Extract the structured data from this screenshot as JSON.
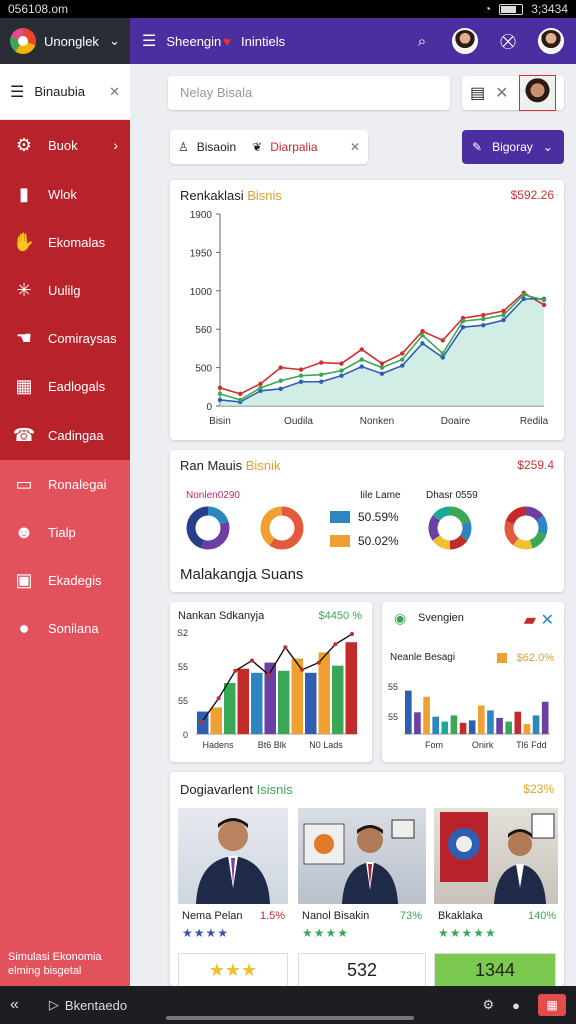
{
  "status": {
    "time": "056108.om",
    "battery": "3;3434",
    "battery_level": 0.75
  },
  "app": {
    "name": "Unonglek",
    "header_title": "Sheengin",
    "header_subtitle": "Inintiels"
  },
  "sidebar": {
    "title": "Binaubia",
    "items": [
      {
        "label": "Buok",
        "icon": "gear-icon"
      },
      {
        "label": "Wlok",
        "icon": "bag-icon"
      },
      {
        "label": "Ekomalas",
        "icon": "hand-coins-icon"
      },
      {
        "label": "Uulilg",
        "icon": "sparkle-icon"
      },
      {
        "label": "Comiraysas",
        "icon": "hand-icon"
      },
      {
        "label": "Eadlogals",
        "icon": "grid-icon"
      },
      {
        "label": "Cadingaa",
        "icon": "phone-icon"
      },
      {
        "label": "Ronalegai",
        "icon": "calendar-icon"
      },
      {
        "label": "Tialp",
        "icon": "users-icon"
      },
      {
        "label": "Ekadegis",
        "icon": "wallet-icon"
      },
      {
        "label": "Sonilana",
        "icon": "person-icon"
      }
    ],
    "footer": [
      "Simulasi Ekonomia",
      "elming bisgetal"
    ]
  },
  "search": {
    "placeholder": "Nelay Bisala"
  },
  "filter_chip": {
    "label": "Bisaoin",
    "tag": "Diarpalia"
  },
  "primary_button": {
    "label": "Bigoray"
  },
  "card1": {
    "title": "Renkaklasi",
    "accent": "Bisnis",
    "value": "$592.26"
  },
  "card2": {
    "title": "Ran Mauis",
    "accent": "Bisnik",
    "value": "$259.4",
    "label1": "Nonlen0290",
    "label2": "Iile Lame",
    "label3": "Dhasr 0559",
    "legend": [
      {
        "value": "50.59%",
        "color": "#2e86c1"
      },
      {
        "value": "50.02%",
        "color": "#f0a030"
      }
    ],
    "subtitle": "Malakangja Suans"
  },
  "card3": {
    "title": "Nankan Sdkanyja",
    "value": "$4450 %"
  },
  "card4": {
    "title": "Svengien",
    "sub": "Neanle Besagi",
    "value": "$62.0%"
  },
  "card5": {
    "title": "Dogiavarlent",
    "accent": "Isisnis",
    "value": "$23%",
    "people": [
      {
        "name": "Nema Pelan",
        "pct": "1.5%",
        "stars": "★★★★"
      },
      {
        "name": "Nanol Bisakin",
        "pct": "73%",
        "stars": "★★★★"
      },
      {
        "name": "Bkaklaka",
        "pct": "140%",
        "stars": "★★★★★"
      }
    ],
    "mini": [
      "★★★",
      "532",
      "1344"
    ]
  },
  "nav": {
    "label": "Bkentaedo"
  },
  "chart_data": [
    {
      "type": "line",
      "xlabels": [
        "Bisin",
        "Oudila",
        "Nonken",
        "Doaire",
        "Redila"
      ],
      "ytick_labels": [
        "0",
        "500",
        "560",
        "1000",
        "1950",
        "1900"
      ],
      "ylim": [
        0,
        1900
      ],
      "x": [
        0,
        1,
        2,
        3,
        4,
        5,
        6,
        7,
        8,
        9,
        10,
        11,
        12,
        13,
        14,
        15,
        16
      ],
      "series": [
        {
          "color": "#d23030",
          "values": [
            180,
            120,
            220,
            380,
            360,
            430,
            420,
            560,
            420,
            520,
            740,
            650,
            870,
            900,
            940,
            1120,
            1000
          ]
        },
        {
          "color": "#2e5fb3",
          "values": [
            60,
            40,
            150,
            170,
            240,
            240,
            300,
            390,
            320,
            400,
            620,
            480,
            780,
            800,
            850,
            1060,
            1060
          ]
        },
        {
          "color": "#3aa757",
          "values": [
            120,
            60,
            180,
            250,
            300,
            310,
            350,
            460,
            380,
            460,
            700,
            520,
            840,
            860,
            900,
            1100,
            1050
          ]
        }
      ]
    },
    {
      "type": "pie",
      "donuts": [
        {
          "slices": [
            {
              "value": 20,
              "color": "#2e86c1"
            },
            {
              "value": 35,
              "color": "#6c3fa3"
            },
            {
              "value": 45,
              "color": "#2a3f8a"
            }
          ]
        },
        {
          "slices": [
            {
              "value": 60,
              "color": "#e25a3a"
            },
            {
              "value": 40,
              "color": "#f0a030"
            }
          ]
        },
        {
          "slices": [
            {
              "value": 20,
              "color": "#3aa757"
            },
            {
              "value": 15,
              "color": "#2e86c1"
            },
            {
              "value": 15,
              "color": "#c32a2a"
            },
            {
              "value": 15,
              "color": "#f0c030"
            },
            {
              "value": 20,
              "color": "#6c3fa3"
            },
            {
              "value": 15,
              "color": "#1aa89a"
            }
          ]
        },
        {
          "slices": [
            {
              "value": 15,
              "color": "#6c3fa3"
            },
            {
              "value": 15,
              "color": "#2e86c1"
            },
            {
              "value": 15,
              "color": "#3aa757"
            },
            {
              "value": 15,
              "color": "#f0c030"
            },
            {
              "value": 20,
              "color": "#e25a3a"
            },
            {
              "value": 20,
              "color": "#c32a2a"
            }
          ]
        }
      ]
    },
    {
      "type": "bar",
      "categories": [
        "Hadens",
        "Bt6 Blk",
        "N0 Lads"
      ],
      "ytick_labels": [
        "0",
        "55",
        "55",
        "S2"
      ],
      "ylim": [
        0,
        100
      ],
      "values": [
        22,
        26,
        50,
        64,
        60,
        70,
        62,
        74,
        60,
        80,
        67,
        90
      ],
      "colors": [
        "#2e5fb3",
        "#f0a030",
        "#3aa757",
        "#c32a2a",
        "#2e86c1",
        "#6c3fa3",
        "#3aa757",
        "#f0a030",
        "#2e5fb3",
        "#f0a030",
        "#3aa757",
        "#c32a2a"
      ],
      "trend": [
        12,
        35,
        62,
        72,
        58,
        85,
        63,
        70,
        88,
        98
      ]
    },
    {
      "type": "bar",
      "categories": [
        "Fom",
        "Onirk",
        "Tl6 Fdd"
      ],
      "ytick_labels": [
        "55",
        "55"
      ],
      "ylim": [
        0,
        100
      ],
      "values": [
        70,
        35,
        60,
        28,
        20,
        30,
        18,
        22,
        46,
        38,
        26,
        20,
        36,
        16,
        30,
        52
      ],
      "colors": [
        "#2e5fb3",
        "#6c3fa3",
        "#f0a030",
        "#2e86c1",
        "#1aa89a",
        "#3aa757",
        "#c32a2a",
        "#2e5fb3",
        "#f0a030",
        "#2e86c1",
        "#6c3fa3",
        "#3aa757",
        "#c32a2a",
        "#f0a030",
        "#2e86c1",
        "#6c3fa3"
      ]
    }
  ]
}
